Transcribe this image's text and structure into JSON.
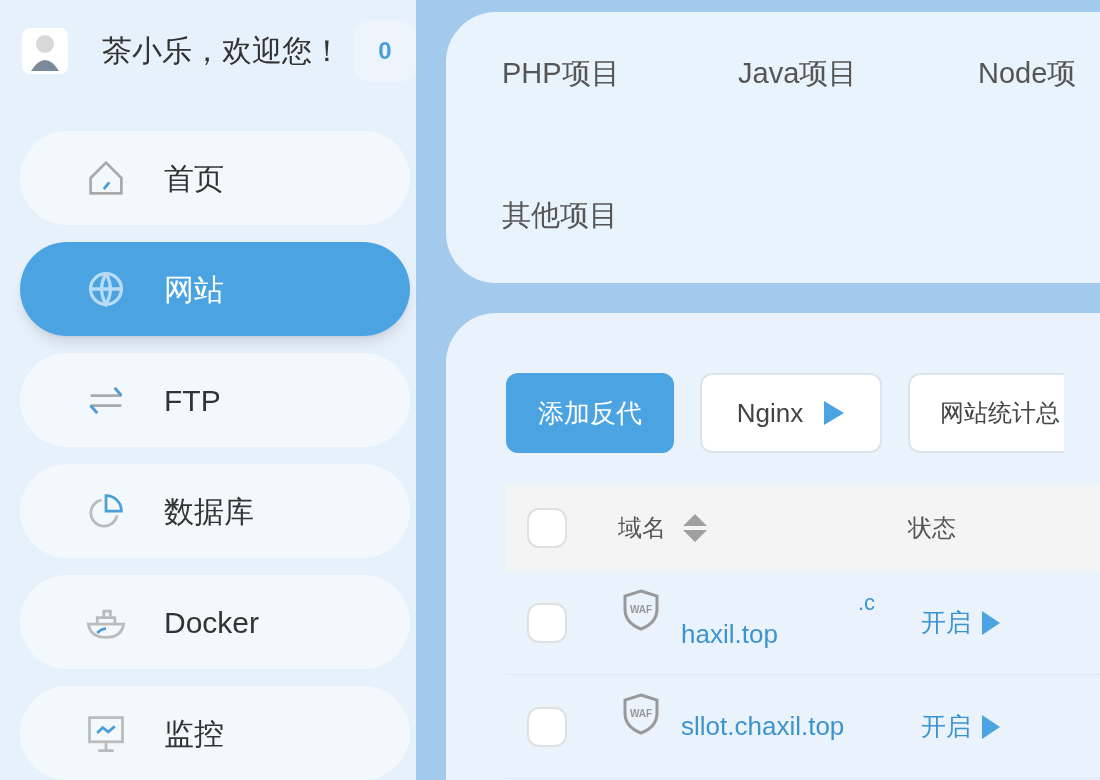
{
  "user": {
    "greeting": "茶小乐，欢迎您！",
    "badge": "0"
  },
  "sidebar": {
    "items": [
      {
        "label": "首页",
        "kind": "home",
        "selected": false
      },
      {
        "label": "网站",
        "kind": "globe",
        "selected": true
      },
      {
        "label": "FTP",
        "kind": "transfer",
        "selected": false
      },
      {
        "label": "数据库",
        "kind": "database",
        "selected": false
      },
      {
        "label": "Docker",
        "kind": "docker",
        "selected": false
      },
      {
        "label": "监控",
        "kind": "monitor",
        "selected": false
      }
    ]
  },
  "project_tabs": [
    {
      "label": "PHP项目"
    },
    {
      "label": "Java项目"
    },
    {
      "label": "Node项"
    },
    {
      "label": "其他项目"
    }
  ],
  "toolbar": [
    {
      "label": "添加反代",
      "kind": "primary"
    },
    {
      "label": "Nginx",
      "kind": "play"
    },
    {
      "label": "网站统计总",
      "kind": "plain"
    }
  ],
  "table": {
    "select_all_checked": false,
    "columns": [
      "域名",
      "状态"
    ],
    "rows": [
      {
        "checked": false,
        "waf": "WAF",
        "domain": [
          "haxil.top"
        ],
        "domain_fragment": ".c",
        "status": "开启"
      },
      {
        "checked": false,
        "waf": "WAF",
        "domain": [
          "sllot.chaxil.top"
        ],
        "status": "开启"
      }
    ]
  }
}
